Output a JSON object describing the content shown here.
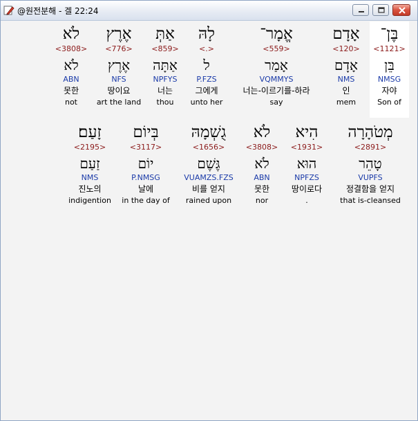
{
  "window": {
    "title": "@원전분해 - 겔 22:24",
    "app_icon": "pen-edit-icon",
    "buttons": [
      "minimize-icon",
      "maximize-icon",
      "close-icon"
    ]
  },
  "colors": {
    "strongs": "#8b1a1a",
    "parsing": "#1a3aa8",
    "highlight": "#ffffff"
  },
  "rows": [
    {
      "words": [
        {
          "hebrew": "בֶּן־",
          "strongs": "<1121>",
          "lemma": "בֵּן",
          "parsing": "NMSG",
          "korean": "자야",
          "english": "Son of",
          "selected": true
        },
        {
          "hebrew": "אָדָם",
          "strongs": "<120>",
          "lemma": "אָדָם",
          "parsing": "NMS",
          "korean": "인",
          "english": "mem"
        },
        {
          "hebrew": "אֱמָר־",
          "strongs": "<559>",
          "lemma": "אָמַר",
          "parsing": "VQMMYS",
          "korean": "너는-이르기를-하라",
          "english": "say"
        },
        {
          "hebrew": "לָהּ",
          "strongs": "<.>",
          "lemma": "ל",
          "parsing": "P.FZS",
          "korean": "그에게",
          "english": "unto her"
        },
        {
          "hebrew": "אַתְּ",
          "strongs": "<859>",
          "lemma": "אַתָּה",
          "parsing": "NPFYS",
          "korean": "너는",
          "english": "thou"
        },
        {
          "hebrew": "אֶרֶץ",
          "strongs": "<776>",
          "lemma": "אֶרֶץ",
          "parsing": "NFS",
          "korean": "땅이요",
          "english": "art the land"
        },
        {
          "hebrew": "לֹא",
          "strongs": "<3808>",
          "lemma": "לֹא",
          "parsing": "ABN",
          "korean": "못한",
          "english": "not"
        }
      ]
    },
    {
      "words": [
        {
          "hebrew": "מְטֹהָרָה",
          "strongs": "<2891>",
          "lemma": "טָהֵר",
          "parsing": "VUPFS",
          "korean": "정결함을 얻지",
          "english": "that is-cleansed"
        },
        {
          "hebrew": "הִיא",
          "strongs": "<1931>",
          "lemma": "הוּא",
          "parsing": "NPFZS",
          "korean": "땅이로다",
          "english": "."
        },
        {
          "hebrew": "לֹא",
          "strongs": "<3808>",
          "lemma": "לֹא",
          "parsing": "ABN",
          "korean": "못한",
          "english": "nor"
        },
        {
          "hebrew": "גֻשְׁמָהּ",
          "strongs": "<1656>",
          "lemma": "גֶּשֶׁם",
          "parsing": "VUAMZS.FZS",
          "korean": "비를 얻지",
          "english": "rained upon"
        },
        {
          "hebrew": "בְּיוֹם",
          "strongs": "<3117>",
          "lemma": "יוֹם",
          "parsing": "P.NMSG",
          "korean": "날에",
          "english": "in the day of"
        },
        {
          "hebrew": "זָעַם׃",
          "strongs": "<2195>",
          "lemma": "זַעַם",
          "parsing": "NMS",
          "korean": "진노의",
          "english": "indigention"
        }
      ]
    }
  ]
}
